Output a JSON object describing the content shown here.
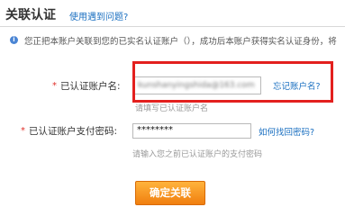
{
  "header": {
    "title": "关联认证",
    "help_link": "使用遇到问题?"
  },
  "info": {
    "icon": "i",
    "text": "您正把本账户关联到您的已实名认证账户（），成功后本账户获得实名认证身份，将"
  },
  "form": {
    "required_mark": "*",
    "account": {
      "label": "已认证账户名:",
      "value": "kunshanyingshida@163.com",
      "forgot_link": "忘记账户名?",
      "hint": "请填写已认证账户名"
    },
    "password": {
      "label": "已认证账户支付密码:",
      "value": "********",
      "recover_link": "如何找回密码?",
      "hint": "请输入您之前已认证账户的支付密码"
    },
    "submit_label": "确定关联"
  },
  "colors": {
    "link": "#1a6fc0",
    "highlight_box": "#e3201e",
    "submit": "#f29120",
    "required": "#e0302a"
  }
}
